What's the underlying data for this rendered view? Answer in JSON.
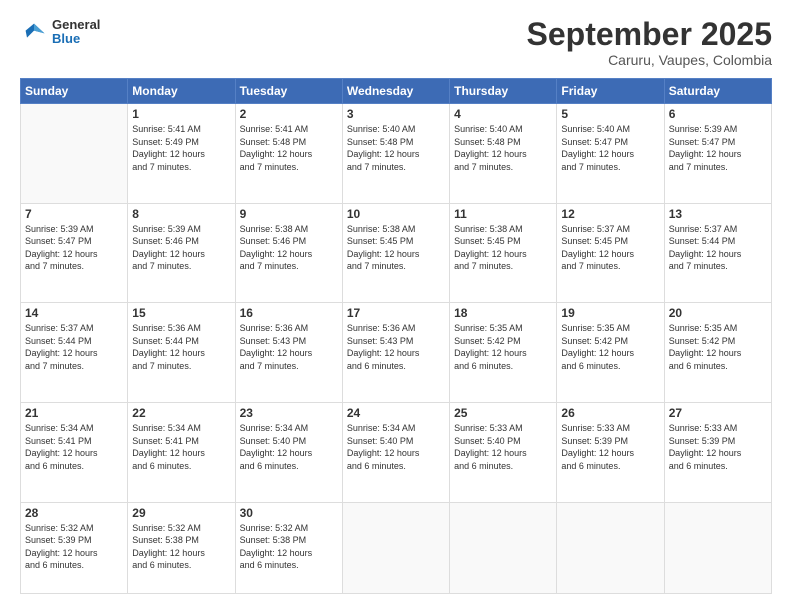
{
  "header": {
    "logo_line1": "General",
    "logo_line2": "Blue",
    "month": "September 2025",
    "location": "Caruru, Vaupes, Colombia"
  },
  "weekdays": [
    "Sunday",
    "Monday",
    "Tuesday",
    "Wednesday",
    "Thursday",
    "Friday",
    "Saturday"
  ],
  "weeks": [
    [
      {
        "day": "",
        "info": ""
      },
      {
        "day": "1",
        "info": "Sunrise: 5:41 AM\nSunset: 5:49 PM\nDaylight: 12 hours\nand 7 minutes."
      },
      {
        "day": "2",
        "info": "Sunrise: 5:41 AM\nSunset: 5:48 PM\nDaylight: 12 hours\nand 7 minutes."
      },
      {
        "day": "3",
        "info": "Sunrise: 5:40 AM\nSunset: 5:48 PM\nDaylight: 12 hours\nand 7 minutes."
      },
      {
        "day": "4",
        "info": "Sunrise: 5:40 AM\nSunset: 5:48 PM\nDaylight: 12 hours\nand 7 minutes."
      },
      {
        "day": "5",
        "info": "Sunrise: 5:40 AM\nSunset: 5:47 PM\nDaylight: 12 hours\nand 7 minutes."
      },
      {
        "day": "6",
        "info": "Sunrise: 5:39 AM\nSunset: 5:47 PM\nDaylight: 12 hours\nand 7 minutes."
      }
    ],
    [
      {
        "day": "7",
        "info": "Sunrise: 5:39 AM\nSunset: 5:47 PM\nDaylight: 12 hours\nand 7 minutes."
      },
      {
        "day": "8",
        "info": "Sunrise: 5:39 AM\nSunset: 5:46 PM\nDaylight: 12 hours\nand 7 minutes."
      },
      {
        "day": "9",
        "info": "Sunrise: 5:38 AM\nSunset: 5:46 PM\nDaylight: 12 hours\nand 7 minutes."
      },
      {
        "day": "10",
        "info": "Sunrise: 5:38 AM\nSunset: 5:45 PM\nDaylight: 12 hours\nand 7 minutes."
      },
      {
        "day": "11",
        "info": "Sunrise: 5:38 AM\nSunset: 5:45 PM\nDaylight: 12 hours\nand 7 minutes."
      },
      {
        "day": "12",
        "info": "Sunrise: 5:37 AM\nSunset: 5:45 PM\nDaylight: 12 hours\nand 7 minutes."
      },
      {
        "day": "13",
        "info": "Sunrise: 5:37 AM\nSunset: 5:44 PM\nDaylight: 12 hours\nand 7 minutes."
      }
    ],
    [
      {
        "day": "14",
        "info": "Sunrise: 5:37 AM\nSunset: 5:44 PM\nDaylight: 12 hours\nand 7 minutes."
      },
      {
        "day": "15",
        "info": "Sunrise: 5:36 AM\nSunset: 5:44 PM\nDaylight: 12 hours\nand 7 minutes."
      },
      {
        "day": "16",
        "info": "Sunrise: 5:36 AM\nSunset: 5:43 PM\nDaylight: 12 hours\nand 7 minutes."
      },
      {
        "day": "17",
        "info": "Sunrise: 5:36 AM\nSunset: 5:43 PM\nDaylight: 12 hours\nand 6 minutes."
      },
      {
        "day": "18",
        "info": "Sunrise: 5:35 AM\nSunset: 5:42 PM\nDaylight: 12 hours\nand 6 minutes."
      },
      {
        "day": "19",
        "info": "Sunrise: 5:35 AM\nSunset: 5:42 PM\nDaylight: 12 hours\nand 6 minutes."
      },
      {
        "day": "20",
        "info": "Sunrise: 5:35 AM\nSunset: 5:42 PM\nDaylight: 12 hours\nand 6 minutes."
      }
    ],
    [
      {
        "day": "21",
        "info": "Sunrise: 5:34 AM\nSunset: 5:41 PM\nDaylight: 12 hours\nand 6 minutes."
      },
      {
        "day": "22",
        "info": "Sunrise: 5:34 AM\nSunset: 5:41 PM\nDaylight: 12 hours\nand 6 minutes."
      },
      {
        "day": "23",
        "info": "Sunrise: 5:34 AM\nSunset: 5:40 PM\nDaylight: 12 hours\nand 6 minutes."
      },
      {
        "day": "24",
        "info": "Sunrise: 5:34 AM\nSunset: 5:40 PM\nDaylight: 12 hours\nand 6 minutes."
      },
      {
        "day": "25",
        "info": "Sunrise: 5:33 AM\nSunset: 5:40 PM\nDaylight: 12 hours\nand 6 minutes."
      },
      {
        "day": "26",
        "info": "Sunrise: 5:33 AM\nSunset: 5:39 PM\nDaylight: 12 hours\nand 6 minutes."
      },
      {
        "day": "27",
        "info": "Sunrise: 5:33 AM\nSunset: 5:39 PM\nDaylight: 12 hours\nand 6 minutes."
      }
    ],
    [
      {
        "day": "28",
        "info": "Sunrise: 5:32 AM\nSunset: 5:39 PM\nDaylight: 12 hours\nand 6 minutes."
      },
      {
        "day": "29",
        "info": "Sunrise: 5:32 AM\nSunset: 5:38 PM\nDaylight: 12 hours\nand 6 minutes."
      },
      {
        "day": "30",
        "info": "Sunrise: 5:32 AM\nSunset: 5:38 PM\nDaylight: 12 hours\nand 6 minutes."
      },
      {
        "day": "",
        "info": ""
      },
      {
        "day": "",
        "info": ""
      },
      {
        "day": "",
        "info": ""
      },
      {
        "day": "",
        "info": ""
      }
    ]
  ]
}
